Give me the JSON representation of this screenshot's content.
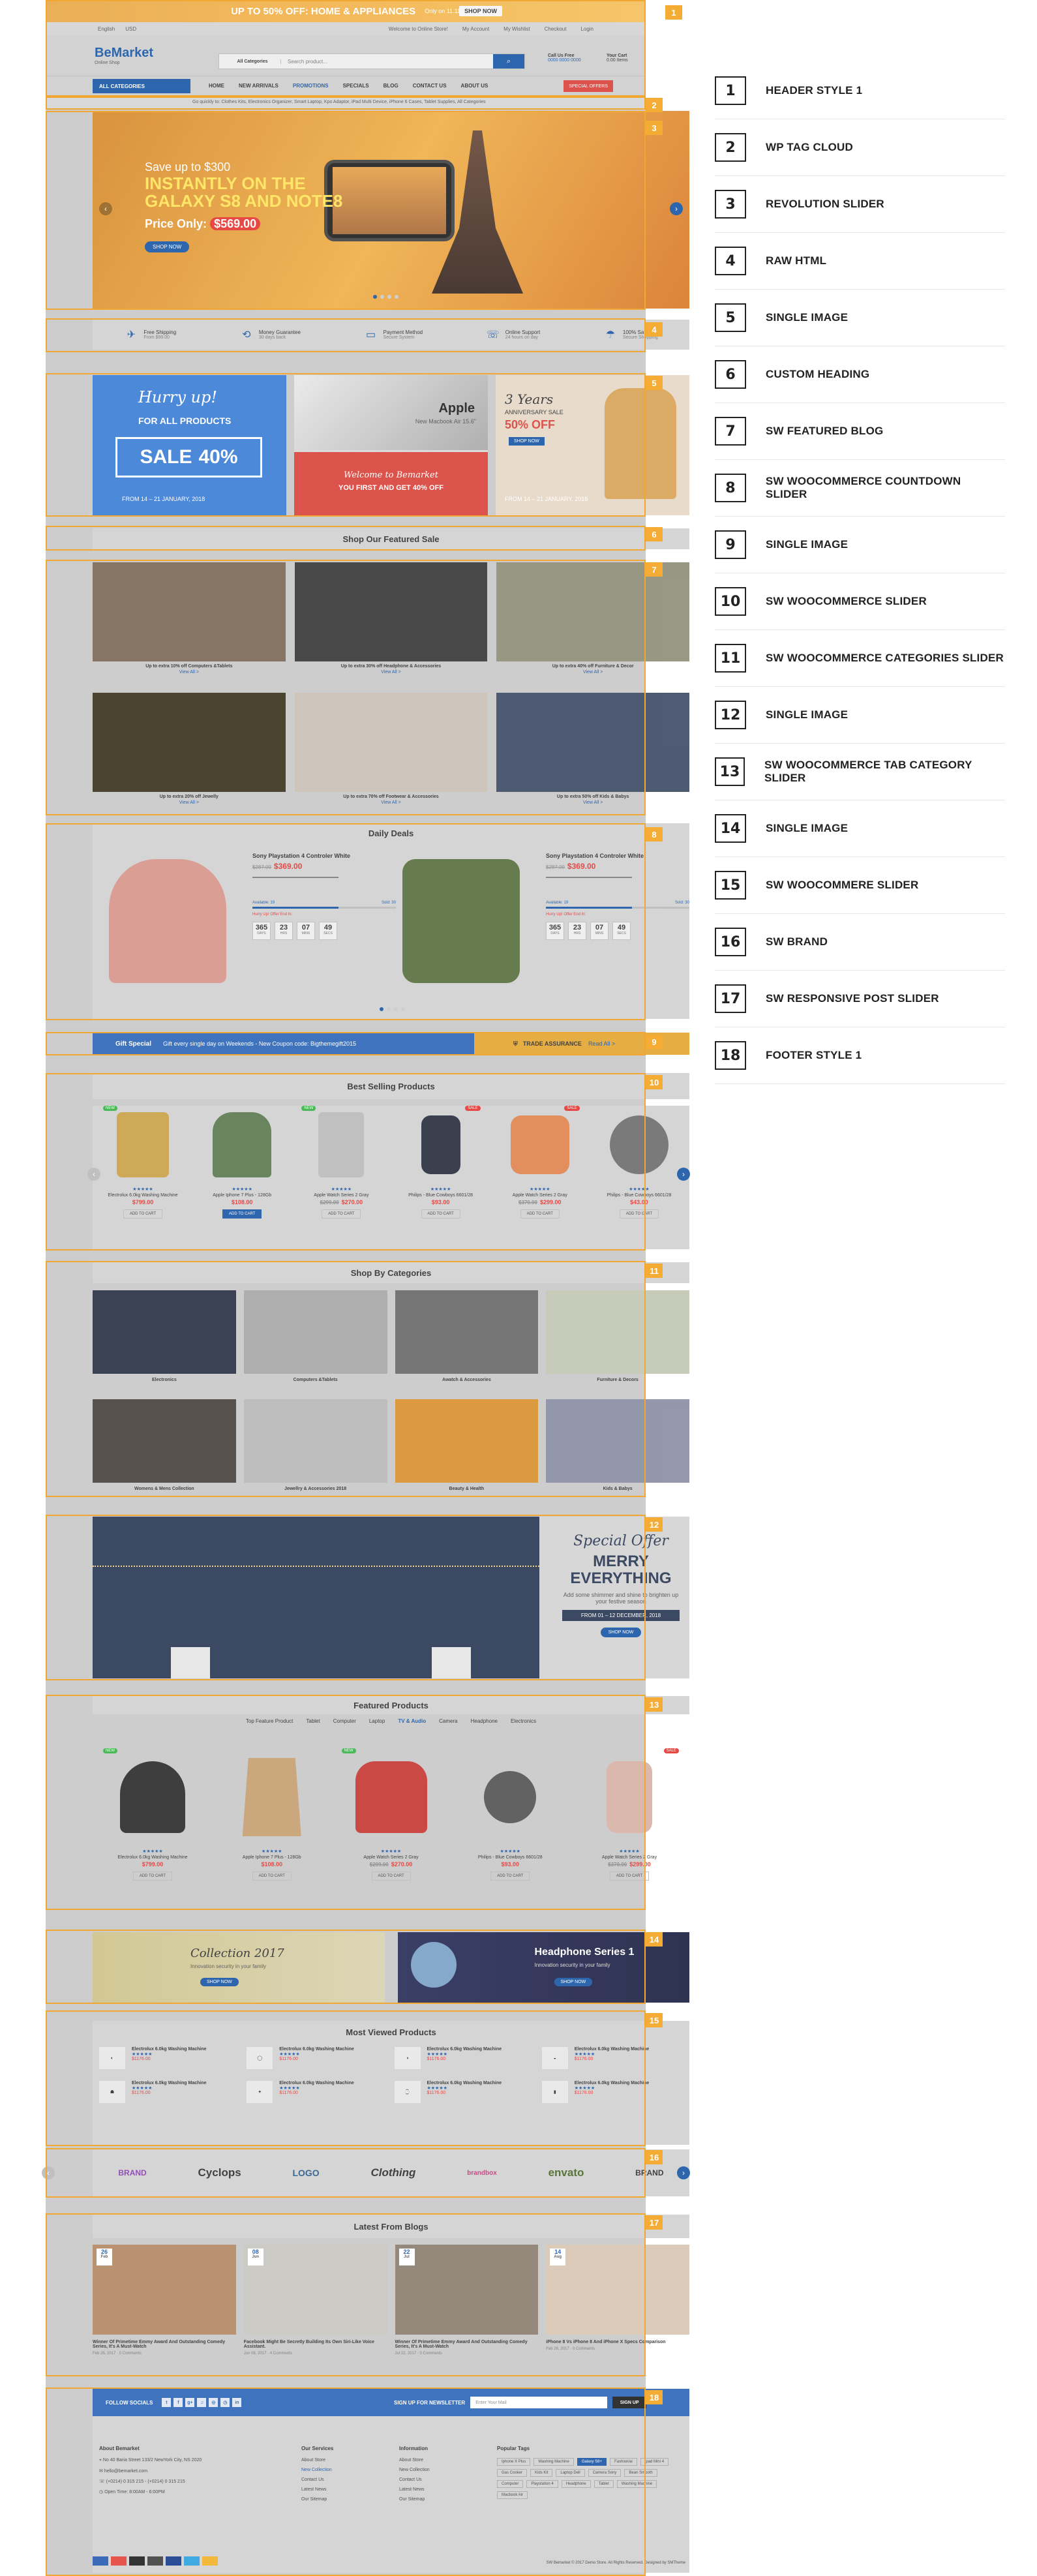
{
  "legend": [
    {
      "num": "1",
      "name": "HEADER STYLE 1"
    },
    {
      "num": "2",
      "name": "WP TAG CLOUD"
    },
    {
      "num": "3",
      "name": "REVOLUTION SLIDER"
    },
    {
      "num": "4",
      "name": "RAW HTML"
    },
    {
      "num": "5",
      "name": "SINGLE IMAGE"
    },
    {
      "num": "6",
      "name": "CUSTOM HEADING"
    },
    {
      "num": "7",
      "name": "SW FEATURED BLOG"
    },
    {
      "num": "8",
      "name": "SW WOOCOMMERCE COUNTDOWN SLIDER"
    },
    {
      "num": "9",
      "name": "SINGLE IMAGE"
    },
    {
      "num": "10",
      "name": "SW WOOCOMMERCE SLIDER"
    },
    {
      "num": "11",
      "name": "SW WOOCOMMERCE CATEGORIES SLIDER"
    },
    {
      "num": "12",
      "name": "SINGLE IMAGE"
    },
    {
      "num": "13",
      "name": "SW WOOCOMMERCE TAB CATEGORY SLIDER"
    },
    {
      "num": "14",
      "name": "SINGLE IMAGE"
    },
    {
      "num": "15",
      "name": "SW WOOCOMMERE SLIDER"
    },
    {
      "num": "16",
      "name": "SW BRAND"
    },
    {
      "num": "17",
      "name": "SW RESPONSIVE POST SLIDER"
    },
    {
      "num": "18",
      "name": "FOOTER STYLE 1"
    }
  ],
  "badges": [
    "1",
    "2",
    "3",
    "4",
    "5",
    "6",
    "7",
    "8",
    "9",
    "10",
    "11",
    "12",
    "13",
    "14",
    "15",
    "16",
    "17",
    "18"
  ],
  "topbanner": {
    "text": "UP TO 50% OFF: HOME & APPLIANCES",
    "note": "Only on 11.11",
    "cta": "SHOP NOW"
  },
  "util": {
    "lang": "English",
    "currency": "USD",
    "welcome": "Welcome to Online Store!",
    "account": "My Account",
    "wishlist": "My Wishlist",
    "checkout": "Checkout",
    "login": "Login"
  },
  "header": {
    "logo": "BeMarket",
    "logo_sub": "Online Shop",
    "category": "All Categories",
    "search_placeholder": "Search product...",
    "call_label": "Call Us Free",
    "call_number": "0000 0000 0000",
    "cart_label": "Your Cart",
    "cart_value": "0.00 Items"
  },
  "nav": {
    "allcat": "ALL CATEGORIES",
    "items": [
      "HOME",
      "NEW ARRIVALS",
      "PROMOTIONS",
      "SPECIALS",
      "BLOG",
      "CONTACT US",
      "ABOUT US"
    ],
    "special": "SPECIAL OFFERS"
  },
  "tagcloud": "Go quickly to: Clothes Kits, Electronics Organizer, Smart Laptop, Kpo Adaptor, iPad Multi Device, iPhone 6 Cases, Tablet Supplies, All Categories",
  "slider": {
    "line1": "Save up to $300",
    "line2": "INSTANTLY ON THE GALAXY S8 AND NOTE8",
    "price_label": "Price Only:",
    "price": "$569.00",
    "button": "SHOP NOW"
  },
  "features": [
    {
      "icon": "✈",
      "title": "Free Shipping",
      "sub": "From $99.00"
    },
    {
      "icon": "⟲",
      "title": "Money Guarantee",
      "sub": "30 days back"
    },
    {
      "icon": "▭",
      "title": "Payment Method",
      "sub": "Secure System"
    },
    {
      "icon": "☏",
      "title": "Online Support",
      "sub": "24 hours on day"
    },
    {
      "icon": "☂",
      "title": "100% Safe",
      "sub": "Secure Shopping"
    }
  ],
  "banners": {
    "a_title": "Hurry up!",
    "a_sub": "FOR ALL PRODUCTS",
    "a_sale": "SALE",
    "a_pct": "40%",
    "a_dates": "FROM 14 – 21 JANUARY, 2018",
    "b_brand": "Apple",
    "b_model": "New Macbook Air 15.6\"",
    "b_welcome": "Welcome to Bemarket",
    "b_offer": "YOU FIRST AND GET 40% OFF",
    "c_years": "3 Years",
    "c_title": "ANNIVERSARY SALE",
    "c_pct": "50% OFF",
    "c_btn": "SHOP NOW",
    "c_dates": "FROM 14 – 21 JANUARY, 2018"
  },
  "featured_heading": "Shop Our Featured Sale",
  "featured_blog": [
    {
      "cap": "Up to extra 10% off Computers &Tablets",
      "link": "View All >",
      "color": "#7c6a58"
    },
    {
      "cap": "Up to extra 30% off Headphone & Accessories",
      "link": "View All >",
      "color": "#3a3a3a"
    },
    {
      "cap": "Up to extra 40% off Furniture & Decor",
      "link": "View All >",
      "color": "#8f8f7a"
    },
    {
      "cap": "Up to extra 20% off Jewelly",
      "link": "View All >",
      "color": "#3b3520"
    },
    {
      "cap": "Up to extra 70% off Footwear & Accessories",
      "link": "View All >",
      "color": "#c9c0b5"
    },
    {
      "cap": "Up to extra 50% off Kids & Babys",
      "link": "View All >",
      "color": "#3f4d66"
    }
  ],
  "deals": {
    "heading": "Daily Deals",
    "items": [
      {
        "name": "Sony Playstation 4 Controler White",
        "old": "$287.00",
        "price": "$369.00",
        "avail": "Available: 19",
        "sold": "Sold: 30",
        "offer": "Hurry Up! Offer End In:",
        "d": "365",
        "h": "23",
        "m": "07",
        "s": "49",
        "color": "#d9968c"
      },
      {
        "name": "Sony Playstation 4 Controler White",
        "old": "$287.00",
        "price": "$369.00",
        "avail": "Available: 19",
        "sold": "Sold: 30",
        "offer": "Hurry Up! Offer End In:",
        "d": "365",
        "h": "23",
        "m": "07",
        "s": "49",
        "color": "#5a7040"
      }
    ],
    "labels": {
      "d": "DAYS",
      "h": "HRS",
      "m": "MINS",
      "s": "SECS"
    }
  },
  "gift": {
    "title": "Gift Special",
    "text": "Gift every single day on Weekends - New Coupon code: Bigthemegift2015",
    "trade": "TRADE ASSURANCE",
    "trade_link": "Read All >"
  },
  "bestselling": {
    "heading": "Best Selling Products",
    "items": [
      {
        "name": "Electrolux 6.0kg Washing Machine",
        "price": "$799.00",
        "old": "",
        "tag": "NEW",
        "color": "#c9a24a",
        "add": "ADD TO CART"
      },
      {
        "name": "Apple Iphone 7 Plus - 128Gb",
        "price": "$108.00",
        "old": "",
        "tag": "",
        "color": "#5e7a52",
        "add": "ADD TO CART"
      },
      {
        "name": "Apple Watch Series 2 Gray",
        "price": "$270.00",
        "old": "$299.00",
        "tag": "NEW",
        "color": "#bbbbbb",
        "add": "ADD TO CART"
      },
      {
        "name": "Philips - Blue Cowboys 6601/28",
        "price": "$93.00",
        "old": "",
        "tag": "SALE",
        "color": "#2a3040",
        "add": "ADD TO CART"
      },
      {
        "name": "Apple Watch Series 2 Gray",
        "price": "$299.00",
        "old": "$370.00",
        "tag": "SALE",
        "color": "#e08550",
        "add": "ADD TO CART"
      },
      {
        "name": "Philips - Blue Cowboys 6601/28",
        "price": "$43.00",
        "old": "",
        "tag": "",
        "color": "#6f6f6f",
        "add": "ADD TO CART"
      }
    ]
  },
  "categories": {
    "heading": "Shop By Categories",
    "items": [
      {
        "name": "Electronics",
        "color": "#2b3345"
      },
      {
        "name": "Computers &Tablets",
        "color": "#a9a9a9"
      },
      {
        "name": "Awatch & Accessories",
        "color": "#6a6a6a"
      },
      {
        "name": "Furniture & Decors",
        "color": "#c3c7b5"
      },
      {
        "name": "Womens & Mens Collection",
        "color": "#4a4440"
      },
      {
        "name": "Jewellry & Accessories 2018",
        "color": "#b8b8b8"
      },
      {
        "name": "Beauty & Health",
        "color": "#d89230"
      },
      {
        "name": "Kids & Babys",
        "color": "#8a8fa6"
      }
    ]
  },
  "offer": {
    "script": "Special Offer",
    "title": "MERRY EVERYTHING",
    "sub": "Add some shimmer and shine to brighten up your festive season",
    "dates": "FROM 01 – 12 DECEMBER, 2018",
    "btn": "SHOP NOW"
  },
  "featured": {
    "heading": "Featured Products",
    "tabs": [
      "Top Feature Product",
      "Tablet",
      "Computer",
      "Laptop",
      "TV & Audio",
      "Camera",
      "Headphone",
      "Electronics"
    ],
    "active": "TV & Audio",
    "items": [
      {
        "name": "Electrolux 6.0kg Washing Machine",
        "price": "$799.00",
        "old": "",
        "tag": "NEW",
        "color": "#2e2e2e",
        "add": "ADD TO CART"
      },
      {
        "name": "Apple Iphone 7 Plus - 128Gb",
        "price": "$108.00",
        "old": "",
        "tag": "",
        "color": "#c6a073",
        "add": "ADD TO CART"
      },
      {
        "name": "Apple Watch Series 2 Gray",
        "price": "$270.00",
        "old": "$299.00",
        "tag": "NEW",
        "color": "#c63a36",
        "add": "ADD TO CART"
      },
      {
        "name": "Philips - Blue Cowboys 6601/28",
        "price": "$93.00",
        "old": "",
        "tag": "",
        "color": "#555555",
        "add": "ADD TO CART"
      },
      {
        "name": "Apple Watch Series 2 Gray",
        "price": "$299.00",
        "old": "$370.00",
        "tag": "SALE",
        "color": "#d7b3a4",
        "add": "ADD TO CART"
      }
    ]
  },
  "twobanners": {
    "a_title": "Collection 2017",
    "a_sub": "Innovation security in your family",
    "a_btn": "SHOP NOW",
    "b_title": "Headphone Series 1",
    "b_sub": "Innovation security in your family",
    "b_btn": "SHOP NOW"
  },
  "mostviewed": {
    "heading": "Most Viewed Products",
    "items": [
      {
        "name": "Electrolux 6.0kg Washing Machine",
        "price": "$1176.00",
        "icon": "◐"
      },
      {
        "name": "Electrolux 6.0kg Washing Machine",
        "price": "$1176.00",
        "icon": "◯"
      },
      {
        "name": "Electrolux 6.0kg Washing Machine",
        "price": "$1176.00",
        "icon": "◑"
      },
      {
        "name": "Electrolux 6.0kg Washing Machine",
        "price": "$1176.00",
        "icon": "◒"
      },
      {
        "name": "Electrolux 6.0kg Washing Machine",
        "price": "$1176.00",
        "icon": "☗"
      },
      {
        "name": "Electrolux 6.0kg Washing Machine",
        "price": "$1176.00",
        "icon": "✦"
      },
      {
        "name": "Electrolux 6.0kg Washing Machine",
        "price": "$1176.00",
        "icon": "⌚"
      },
      {
        "name": "Electrolux 6.0kg Washing Machine",
        "price": "$1176.00",
        "icon": "▮"
      }
    ]
  },
  "brands": [
    "BRAND",
    "Cyclops",
    "LOGO",
    "Clothing",
    "brandbox",
    "envato",
    "BRAND"
  ],
  "blogs": {
    "heading": "Latest From Blogs",
    "items": [
      {
        "day": "26",
        "mon": "Feb",
        "title": "Winner Of Primetime Emmy Award And Outstanding Comedy Series, It's A Must-Watch",
        "date": "Feb 26, 2017",
        "cm": "0 Comments",
        "color": "#b48a66"
      },
      {
        "day": "08",
        "mon": "Jun",
        "title": "Facebook Might Be Secretly Building Its Own Siri-Like Voice Assistant.",
        "date": "Jun 08, 2017",
        "cm": "4 Comments",
        "color": "#c9c7c2"
      },
      {
        "day": "22",
        "mon": "Jul",
        "title": "Winner Of Primetime Emmy Award And Outstanding Comedy Series, It's A Must-Watch",
        "date": "Jul 22, 2017",
        "cm": "0 Comments",
        "color": "#8c7f70"
      },
      {
        "day": "14",
        "mon": "Aug",
        "title": "iPhone 8 Vs iPhone 8 And iPhone X Specs Comparison",
        "date": "Feb 26, 2017",
        "cm": "0 Comments",
        "color": "#d8c7b3"
      }
    ]
  },
  "footer": {
    "follow": "FOLLOW SOCIALS",
    "socials": [
      "t",
      "f",
      "g+",
      "♫",
      "◎",
      "◷",
      "in"
    ],
    "signup": "SIGN UP FOR NEWSLETTER",
    "nl_placeholder": "Enter Your Mail",
    "nl_btn": "SIGN UP",
    "about_title": "About Bemarket",
    "about": [
      "No 40 Baria Street 133/2 NewYork City, NS 2020",
      "hello@bemarket.com",
      "(+0214) 0 315 215 - (+0214) 0 315 215",
      "Open Time: 8:00AM - 6:00PM"
    ],
    "services_title": "Our Services",
    "services": [
      "About Store",
      "New Collection",
      "Contact Us",
      "Latest News",
      "Our Sitemap"
    ],
    "info_title": "Information",
    "info": [
      "About Store",
      "New Collection",
      "Contact Us",
      "Latest News",
      "Our Sitemap"
    ],
    "tags_title": "Popular Tags",
    "tags": [
      "Iphone X Plus",
      "Washing Machine",
      "Galaxy S8+",
      "Fashion/ai",
      "Ipad Mini 4",
      "Gas Cooker",
      "Kids Kit",
      "Laptop Dell",
      "Camera Sony",
      "Bean Smooth",
      "Computer",
      "Playstation 4",
      "Headphone",
      "Tablet",
      "Washing Machine",
      "Macbook Air"
    ],
    "active_tag": "Galaxy S8+",
    "copyright": "SW Bemarket © 2017 Demo Store. All Rights Reserved. Designed by SMTheme"
  }
}
